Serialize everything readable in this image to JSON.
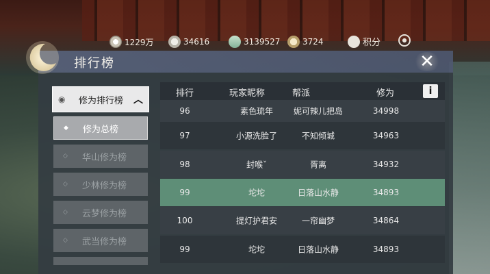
{
  "currencies": [
    {
      "icon": "silver-coin-icon",
      "value": "1229万"
    },
    {
      "icon": "silver-ingot-icon",
      "value": "34616"
    },
    {
      "icon": "jade-icon",
      "value": "3139527"
    },
    {
      "icon": "gold-ingot-icon",
      "value": "3724"
    },
    {
      "icon": "shield-icon",
      "value": "积分"
    },
    {
      "icon": "settings-gear-icon",
      "value": ""
    }
  ],
  "panel": {
    "title": "排行榜",
    "close_glyph": "✕"
  },
  "category": {
    "main_label": "修为排行榜",
    "chevron": "︿"
  },
  "sub_categories": [
    {
      "label": "修为总榜",
      "active": true
    },
    {
      "label": "华山修为榜",
      "active": false
    },
    {
      "label": "少林修为榜",
      "active": false
    },
    {
      "label": "云梦修为榜",
      "active": false
    },
    {
      "label": "武当修为榜",
      "active": false
    }
  ],
  "table": {
    "headers": {
      "rank": "排行",
      "name": "玩家昵称",
      "guild": "帮派",
      "score": "修为"
    },
    "info_glyph": "i",
    "rows": [
      {
        "rank": "96",
        "name": "素色琉年",
        "guild": "妮可辣儿把岛",
        "score": "34998"
      },
      {
        "rank": "97",
        "name": "小源洗脸了",
        "guild": "不知倾城",
        "score": "34963"
      },
      {
        "rank": "98",
        "name": "封喉ˇ",
        "guild": "胥离",
        "score": "34932"
      },
      {
        "rank": "99",
        "name": "坨坨",
        "guild": "日落山水静",
        "score": "34893"
      },
      {
        "rank": "100",
        "name": "提灯护君安",
        "guild": "一帘幽梦",
        "score": "34864"
      },
      {
        "rank": "99",
        "name": "坨坨",
        "guild": "日落山水静",
        "score": "34893"
      }
    ],
    "highlight_color": "#5e8e77"
  }
}
